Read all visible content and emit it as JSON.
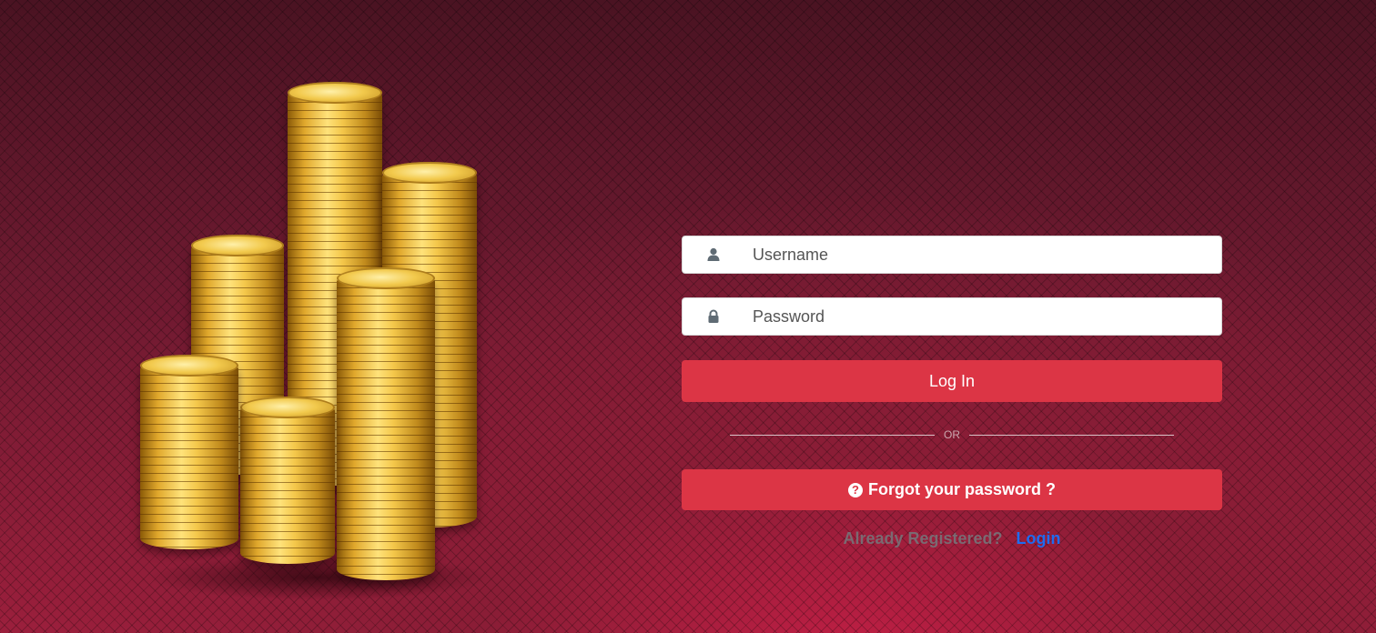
{
  "form": {
    "username": {
      "placeholder": "Username",
      "icon": "user-icon"
    },
    "password": {
      "placeholder": "Password",
      "icon": "lock-icon"
    },
    "login_button": "Log In",
    "or_text": "OR",
    "forgot_button": "Forgot your password ?",
    "forgot_icon": "question-circle-icon",
    "already_registered": "Already Registered?",
    "login_link": "Login"
  },
  "colors": {
    "accent": "#dc3545",
    "link": "#1e6cf0",
    "background": "#6e1a2c"
  }
}
